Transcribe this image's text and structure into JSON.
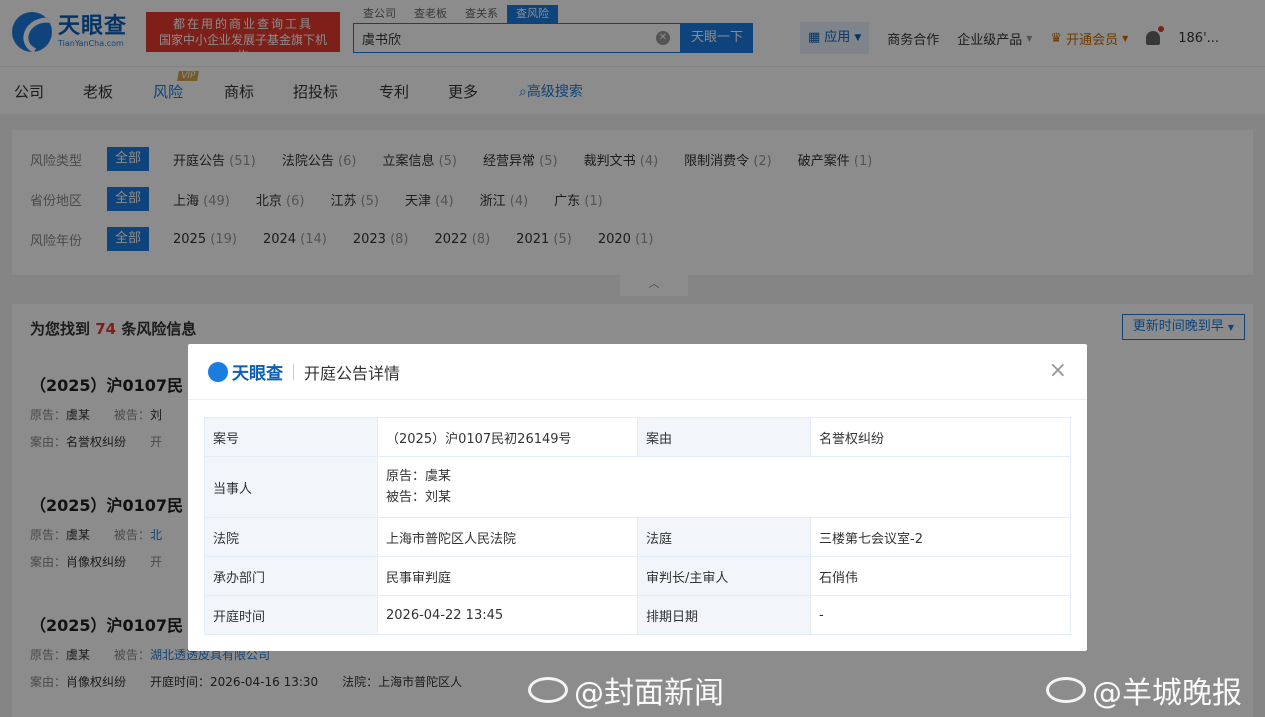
{
  "header": {
    "logo_cn": "天眼查",
    "logo_en": "TianYanCha.com",
    "slogan_line1": "都在用的商业查询工具",
    "slogan_line2": "国家中小企业发展子基金旗下机构",
    "search_tabs": [
      "查公司",
      "查老板",
      "查关系",
      "查风险"
    ],
    "search_value": "虞书欣",
    "search_button": "天眼一下",
    "app_button": "应用",
    "links": [
      "商务合作",
      "企业级产品"
    ],
    "vip_label": "开通会员",
    "user": "186'..."
  },
  "nav": {
    "items": [
      "公司",
      "老板",
      "风险",
      "商标",
      "招投标",
      "专利",
      "更多"
    ],
    "vip_badge": "VIP",
    "advanced": "高级搜索"
  },
  "filters": {
    "all_label": "全部",
    "rows": [
      {
        "label": "风险类型",
        "options": [
          {
            "name": "开庭公告",
            "count": "(51)"
          },
          {
            "name": "法院公告",
            "count": "(6)"
          },
          {
            "name": "立案信息",
            "count": "(5)"
          },
          {
            "name": "经营异常",
            "count": "(5)"
          },
          {
            "name": "裁判文书",
            "count": "(4)"
          },
          {
            "name": "限制消费令",
            "count": "(2)"
          },
          {
            "name": "破产案件",
            "count": "(1)"
          }
        ]
      },
      {
        "label": "省份地区",
        "options": [
          {
            "name": "上海",
            "count": "(49)"
          },
          {
            "name": "北京",
            "count": "(6)"
          },
          {
            "name": "江苏",
            "count": "(5)"
          },
          {
            "name": "天津",
            "count": "(4)"
          },
          {
            "name": "浙江",
            "count": "(4)"
          },
          {
            "name": "广东",
            "count": "(1)"
          }
        ]
      },
      {
        "label": "风险年份",
        "options": [
          {
            "name": "2025",
            "count": "(19)"
          },
          {
            "name": "2024",
            "count": "(14)"
          },
          {
            "name": "2023",
            "count": "(8)"
          },
          {
            "name": "2022",
            "count": "(8)"
          },
          {
            "name": "2021",
            "count": "(5)"
          },
          {
            "name": "2020",
            "count": "(1)"
          }
        ]
      }
    ]
  },
  "results": {
    "prefix": "为您找到",
    "count": "74",
    "suffix": "条风险信息",
    "sort_label": "更新时间晚到早",
    "items": [
      {
        "title": "（2025）沪0107民",
        "plaintiff_label": "原告：",
        "plaintiff": "虞某",
        "defendant_label": "被告：",
        "defendant": "刘",
        "cause_label": "案由：",
        "cause": "名誉权纠纷",
        "extra": "开"
      },
      {
        "title": "（2025）沪0107民",
        "plaintiff_label": "原告：",
        "plaintiff": "虞某",
        "defendant_label": "被告：",
        "defendant": "北",
        "cause_label": "案由：",
        "cause": "肖像权纠纷",
        "extra": "开"
      },
      {
        "title": "（2025）沪0107民",
        "plaintiff_label": "原告：",
        "plaintiff": "虞某",
        "defendant_label": "被告：",
        "defendant": "湖北透透皮具有限公司",
        "cause_label": "案由：",
        "cause": "肖像权纠纷",
        "extra": "开庭时间：2026-04-16 13:30",
        "extra2": "法院：上海市普陀区人"
      }
    ]
  },
  "modal": {
    "logo": "天眼查",
    "title": "开庭公告详情",
    "close": "×",
    "case_no_label": "案号",
    "case_no": "（2025）沪0107民初26149号",
    "cause_label": "案由",
    "cause": "名誉权纠纷",
    "parties_label": "当事人",
    "plaintiff": "原告：虞某",
    "defendant": "被告：刘某",
    "court_label": "法院",
    "court": "上海市普陀区人民法院",
    "room_label": "法庭",
    "room": "三楼第七会议室-2",
    "dept_label": "承办部门",
    "dept": "民事审判庭",
    "judge_label": "审判长/主审人",
    "judge": "石俏伟",
    "time_label": "开庭时间",
    "time": "2026-04-22 13:45",
    "schedule_label": "排期日期",
    "schedule": "-"
  },
  "watermarks": [
    "@封面新闻",
    "@羊城晚报"
  ]
}
